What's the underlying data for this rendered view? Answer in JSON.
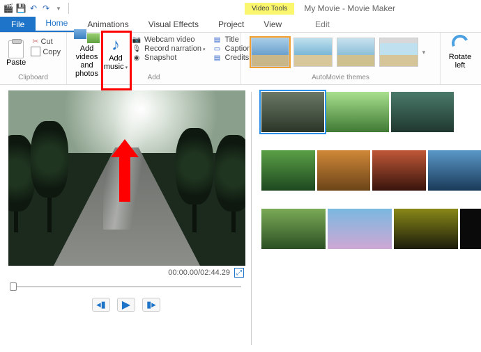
{
  "title": {
    "video_tools": "Video Tools",
    "app": "My Movie - Movie Maker"
  },
  "tabs": {
    "file": "File",
    "home": "Home",
    "animations": "Animations",
    "visual_effects": "Visual Effects",
    "project": "Project",
    "view": "View",
    "edit": "Edit"
  },
  "ribbon": {
    "paste": "Paste",
    "cut": "Cut",
    "copy": "Copy",
    "add_videos": "Add videos and photos",
    "add_music": "Add music",
    "webcam": "Webcam video",
    "record": "Record narration",
    "snapshot": "Snapshot",
    "title_btn": "Title",
    "caption": "Caption",
    "credits": "Credits",
    "rotate_left": "Rotate left",
    "groups": {
      "clipboard": "Clipboard",
      "add": "Add",
      "automovie": "AutoMovie themes"
    }
  },
  "player": {
    "time": "00:00.00/02:44.29"
  }
}
